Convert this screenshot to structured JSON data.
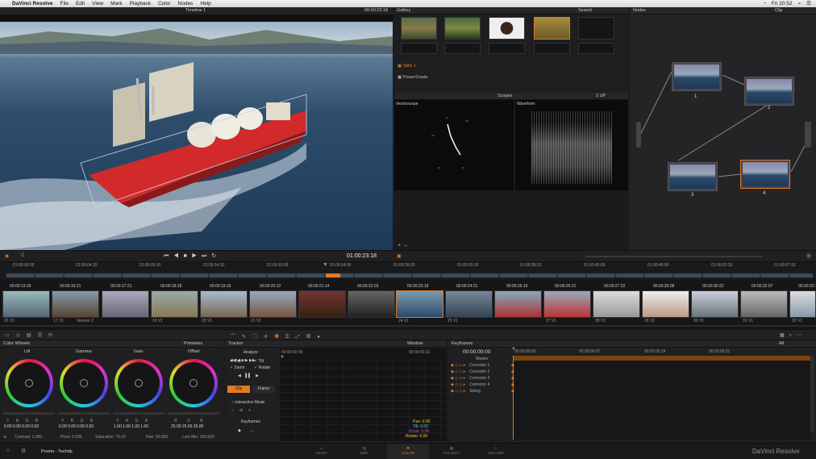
{
  "menubar": {
    "apple": "",
    "app": "DaVinci Resolve",
    "items": [
      "File",
      "Edit",
      "View",
      "Mark",
      "Playback",
      "Color",
      "Nodes",
      "Help"
    ],
    "clock": "Fri 20:52"
  },
  "viewer": {
    "timeline": "Timeline 1",
    "timecode": "00:00:23:18"
  },
  "gallery": {
    "title": "Gallery",
    "search": "Search",
    "stills_label": "Stills 1",
    "powergrade_label": "PowerGrade"
  },
  "nodes": {
    "title": "Nodes",
    "mode": "Clip",
    "labels": [
      "1",
      "2",
      "3",
      "4"
    ]
  },
  "scopes": {
    "title": "Scopes",
    "layout": "2 UP",
    "vectorscope": "Vectorscope",
    "waveform": "Waveform",
    "scale": [
      "896",
      "768",
      "640",
      "512",
      "384",
      "256",
      "128",
      "0"
    ]
  },
  "transport": {
    "timecode": "01:00:23:18"
  },
  "ruler": {
    "ticks": [
      "01:00:00:00",
      "01:00:04:20",
      "01:00:09:15",
      "01:00:14:10",
      "01:00:19:05",
      "01:00:24:00",
      "01:00:28:20",
      "01:00:33:15",
      "01:00:38:10",
      "01:00:43:05",
      "01:00:48:00",
      "01:00:52:20",
      "01:00:57:15"
    ]
  },
  "clips": {
    "timecodes": [
      "00:00:13:16",
      "00:00:16:21",
      "00:00:17:21",
      "00:00:18:18",
      "00:00:19:16",
      "00:00:20:12",
      "00:00:21:14",
      "00:00:22:03",
      "00:00:23:18",
      "00:00:24:21",
      "00:00:25:19",
      "00:00:26:21",
      "00:00:27:22",
      "00:00:29:08",
      "00:00:30:22",
      "00:00:32:07",
      "00:00:33:12"
    ],
    "tracks": [
      "15 V1",
      "17 V1",
      "Version 2",
      "19 V1",
      "20 V1",
      "21 V1",
      "",
      "",
      "24 V1",
      "25 V1",
      "",
      "27 V1",
      "28 V1",
      "29 V1",
      "30 V1",
      "31 V1",
      "32 V1"
    ]
  },
  "colorwheels": {
    "title": "Color Wheels",
    "mode": "Primaries",
    "wheels": [
      {
        "name": "Lift",
        "letters": "Y R G B",
        "values": "0.00 0.00 0.00 0.00"
      },
      {
        "name": "Gamma",
        "letters": "Y R G B",
        "values": "0.00 0.00 0.00 0.00"
      },
      {
        "name": "Gain",
        "letters": "Y R G B",
        "values": "1.00 1.00 1.00 1.00"
      },
      {
        "name": "Offset",
        "letters": "R G B",
        "values": "25.00 25.00 25.00"
      }
    ],
    "footer": {
      "contrast": "Contrast: 1.000",
      "pivot": "Pivot: 0.500",
      "saturation": "Saturation: 75.00",
      "hue": "Hue: 50.000",
      "lummix": "Lum Mix: 100.000"
    }
  },
  "tracker": {
    "title": "Tracker",
    "window": "Window",
    "analyze": "Analyze",
    "options": [
      "Pan",
      "Tilt",
      "Zoom",
      "Rotate"
    ],
    "tabs": [
      "Clip",
      "Frame"
    ],
    "interactive": "Interactive Mode",
    "keyframes": "Keyframes",
    "start_tc": "00:00:00:00",
    "end_tc": "00:00:00:22",
    "readout": [
      "Pan: 0.00",
      "Tilt: 0.00",
      "Zoom: 0.00",
      "Rotate: 0.00"
    ]
  },
  "keyframes": {
    "title": "Keyframes",
    "filter": "All",
    "timecode": "00:00:00:00",
    "ticks": [
      "00:00:00:00",
      "00:00:00:07",
      "00:00:00:14",
      "00:00:00:21"
    ],
    "rows": [
      "Master",
      "Corrector 1",
      "Corrector 2",
      "Corrector 3",
      "Corrector 4",
      "Sizing"
    ]
  },
  "bottombar": {
    "project": "Promo - Techdp",
    "pages": [
      "MEDIA",
      "EDIT",
      "COLOR",
      "GALLERY",
      "DELIVER"
    ],
    "brand": "DaVinci Resolve"
  }
}
